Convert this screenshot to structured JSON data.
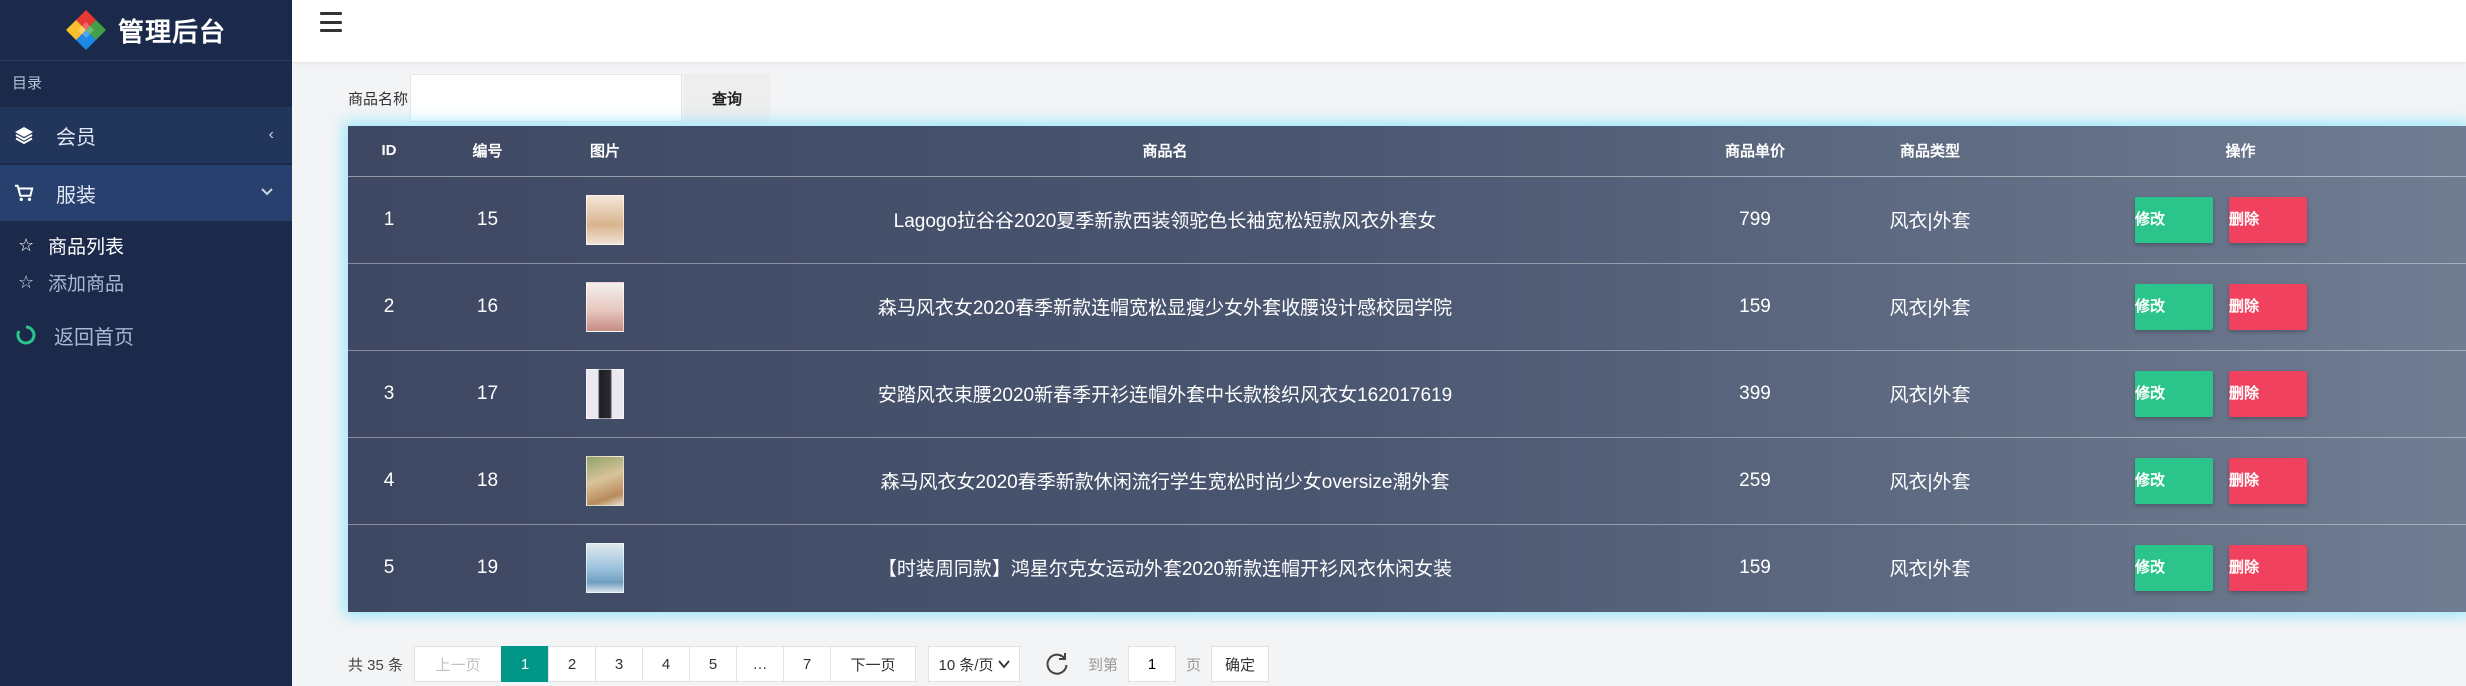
{
  "brand": {
    "title": "管理后台"
  },
  "sidebar": {
    "section_label": "目录",
    "menus": [
      {
        "label": "会员",
        "icon": "layers-icon",
        "arrow": "‹"
      },
      {
        "label": "服装",
        "icon": "cart-icon",
        "arrow": "⌄"
      }
    ],
    "submenu": [
      {
        "label": "商品列表",
        "icon": "star-icon",
        "active": true
      },
      {
        "label": "添加商品",
        "icon": "star-outline-icon",
        "active": false
      }
    ],
    "home": {
      "label": "返回首页",
      "icon": "refresh-ring-icon"
    }
  },
  "search": {
    "label": "商品名称",
    "value": "",
    "placeholder": "",
    "button": "查询"
  },
  "table": {
    "headers": [
      "ID",
      "编号",
      "图片",
      "商品名",
      "商品单价",
      "商品类型",
      "操作"
    ],
    "rows": [
      {
        "id": "1",
        "no": "15",
        "name": "Lagogo拉谷谷2020夏季新款西装领驼色长袖宽松短款风衣外套女",
        "price": "799",
        "type": "风衣|外套"
      },
      {
        "id": "2",
        "no": "16",
        "name": "森马风衣女2020春季新款连帽宽松显瘦少女外套收腰设计感校园学院",
        "price": "159",
        "type": "风衣|外套"
      },
      {
        "id": "3",
        "no": "17",
        "name": "安踏风衣束腰2020新春季开衫连帽外套中长款梭织风衣女162017619",
        "price": "399",
        "type": "风衣|外套"
      },
      {
        "id": "4",
        "no": "18",
        "name": "森马风衣女2020春季新款休闲流行学生宽松时尚少女oversize潮外套",
        "price": "259",
        "type": "风衣|外套"
      },
      {
        "id": "5",
        "no": "19",
        "name": "【时装周同款】鸿星尔克女运动外套2020新款连帽开衫风衣休闲女装",
        "price": "159",
        "type": "风衣|外套"
      }
    ],
    "edit_label": "修改",
    "delete_label": "删除"
  },
  "pager": {
    "total": "共 35 条",
    "prev": "上一页",
    "pages": [
      "1",
      "2",
      "3",
      "4",
      "5"
    ],
    "ellipsis": "…",
    "last": "7",
    "next": "下一页",
    "per_page": "10 条/页",
    "goto_label": "到第",
    "goto_value": "1",
    "page_unit": "页",
    "confirm": "确定"
  },
  "colors": {
    "sidebar": "#1b2a4b",
    "edit": "#2bc48a",
    "delete": "#f0425e",
    "current_page": "#009688",
    "glow": "#50dcff"
  }
}
